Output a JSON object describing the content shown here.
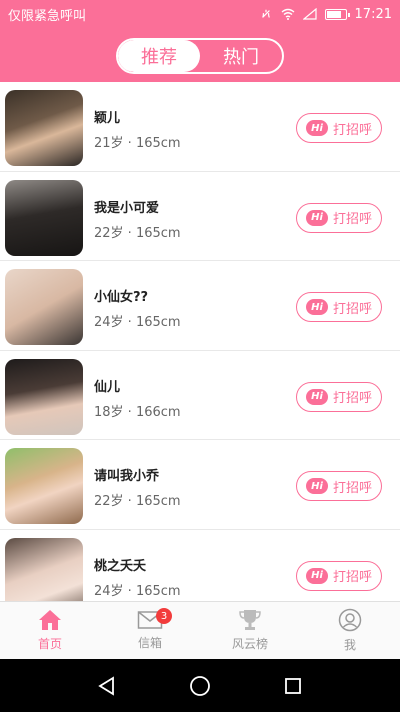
{
  "status_bar": {
    "left_text": "仅限紧急呼叫",
    "time": "17:21",
    "battery_level": 0.7
  },
  "segment": {
    "tabs": [
      {
        "label": "推荐",
        "active": true
      },
      {
        "label": "热门",
        "active": false
      }
    ]
  },
  "list": {
    "greet_label": "打招呼",
    "hi_text": "Hi",
    "items": [
      {
        "name": "颖儿",
        "meta": "21岁 · 165cm"
      },
      {
        "name": "我是小可爱",
        "meta": "22岁 · 165cm"
      },
      {
        "name": "小仙女??",
        "meta": "24岁 · 165cm"
      },
      {
        "name": "仙儿",
        "meta": "18岁 · 166cm"
      },
      {
        "name": "请叫我小乔",
        "meta": "22岁 · 165cm"
      },
      {
        "name": "桃之夭夭",
        "meta": "24岁 · 165cm"
      }
    ]
  },
  "tabbar": {
    "items": [
      {
        "label": "首页",
        "icon": "home-icon",
        "active": true
      },
      {
        "label": "信箱",
        "icon": "mail-icon",
        "badge": "3"
      },
      {
        "label": "风云榜",
        "icon": "trophy-icon"
      },
      {
        "label": "我",
        "icon": "profile-icon"
      }
    ]
  },
  "colors": {
    "accent": "#fb6f98",
    "badge": "#f23c3c"
  }
}
